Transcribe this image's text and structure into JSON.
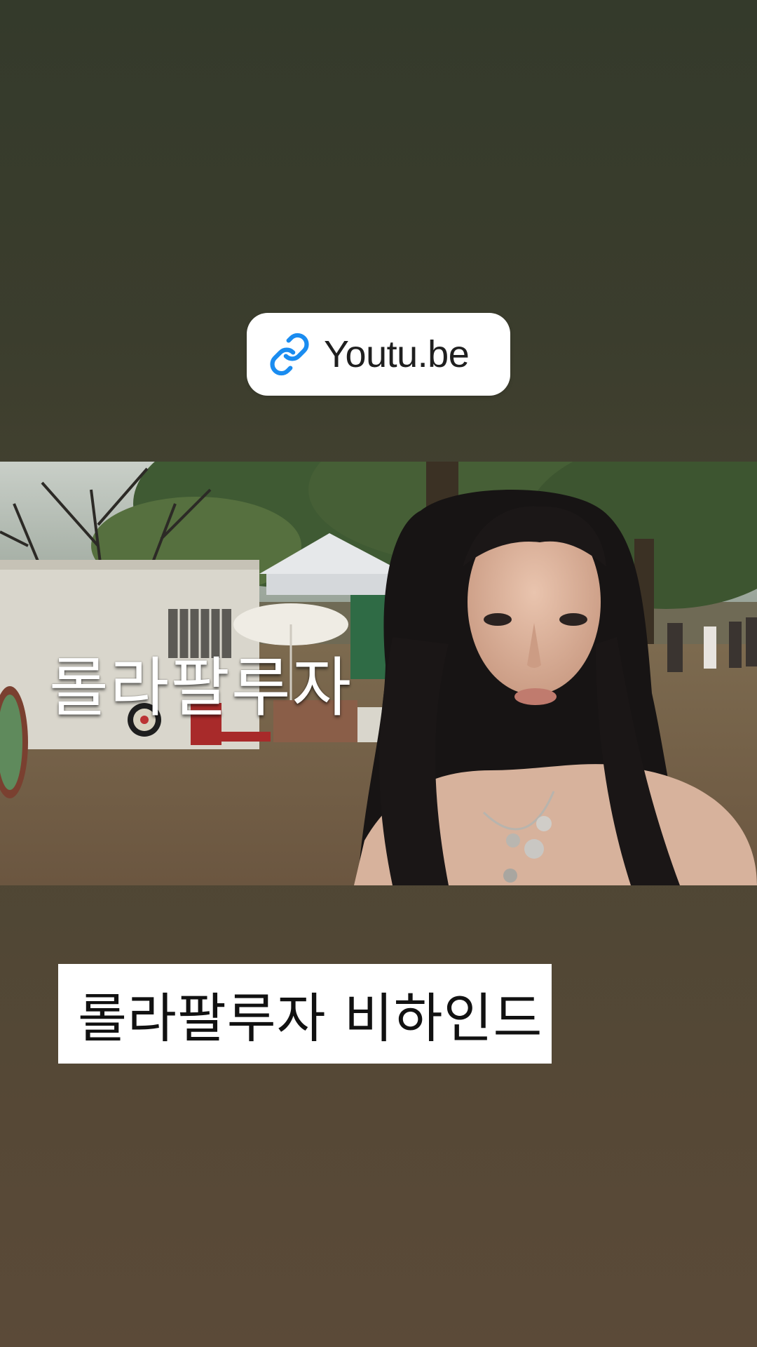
{
  "link_sticker": {
    "label": "Youtu.be",
    "icon": "link-icon",
    "icon_color": "#1a8cf0"
  },
  "video": {
    "overlay_title": "롤라팔루자"
  },
  "caption": {
    "text": "롤라팔루자 비하인드"
  },
  "colors": {
    "background_top": "#343a2b",
    "background_bottom": "#5b4a38",
    "sticker_bg": "#ffffff"
  }
}
